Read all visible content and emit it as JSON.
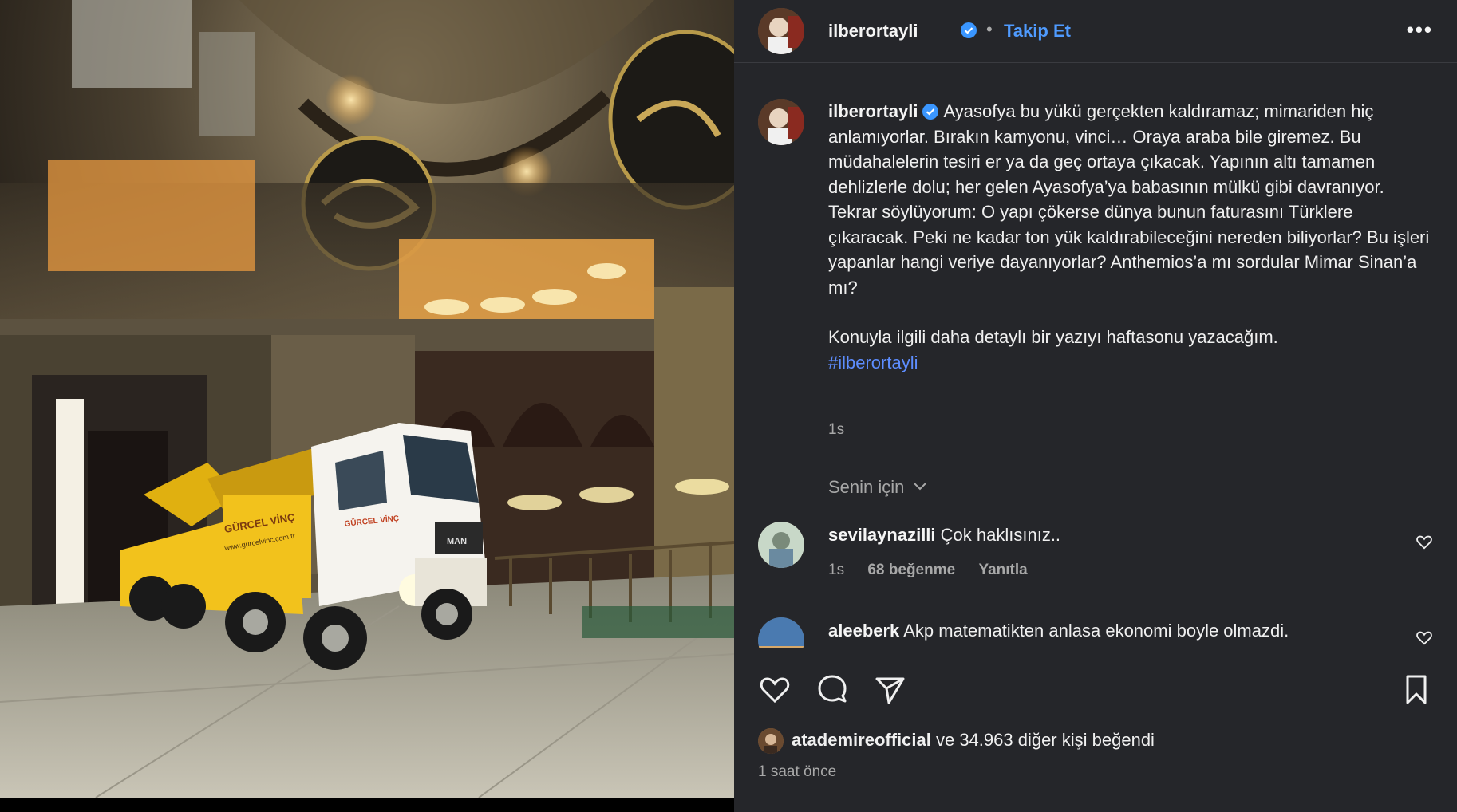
{
  "post": {
    "username": "ilberortayli",
    "follow_label": "Takip Et",
    "more_label": "•••",
    "separator": "•"
  },
  "caption": {
    "username": "ilberortayli",
    "text": "Ayasofya bu yükü gerçekten kaldıramaz; mimariden hiç anlamıyorlar. Bırakın kamyonu, vinci… Oraya araba bile giremez. Bu müdahalelerin tesiri er ya da geç ortaya çıkacak. Yapının altı tamamen dehlizlerle dolu; her gelen Ayasofya’ya babasının mülkü gibi davranıyor. Tekrar söylüyorum: O yapı çökerse dünya bunun faturasını Türklere çıkaracak. Peki ne kadar ton yük kaldırabileceğini nereden biliyorlar? Bu işleri yapanlar hangi veriye dayanıyorlar? Anthemios’a mı sordular Mimar Sinan’a mı?",
    "text2": "Konuyla ilgili daha detaylı bir yazıyı haftasonu yazacağım.",
    "hashtag": "#ilberortayli",
    "time": "1s"
  },
  "comments_header": "Senin için",
  "comments": [
    {
      "username": "sevilaynazilli",
      "text": "Çok haklısınız..",
      "time": "1s",
      "likes": "68 beğenme",
      "reply": "Yanıtla"
    },
    {
      "username": "aleeberk",
      "text": "Akp matematikten anlasa ekonomi boyle olmazdi."
    }
  ],
  "likes": {
    "user": "atademireofficial",
    "rest": "ve 34.963 diğer kişi beğendi",
    "ago": "1 saat önce"
  },
  "photo": {
    "truck_brand": "GÜRCEL VİNÇ",
    "truck_brand_cab": "GÜRCEL VİNÇ",
    "truck_site": "www.gurcelvinc.com.tr",
    "truck_make": "MAN"
  }
}
